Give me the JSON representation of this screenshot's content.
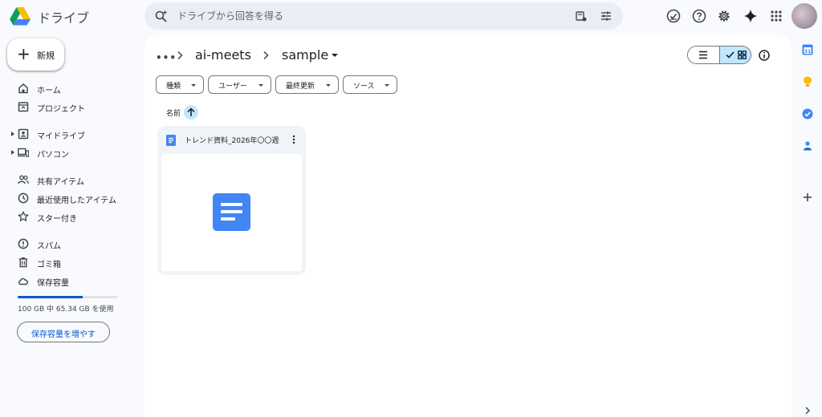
{
  "app": {
    "title": "ドライブ"
  },
  "search": {
    "placeholder": "ドライブから回答を得る"
  },
  "header_icons": [
    "offline-status-icon",
    "help-icon",
    "settings-icon",
    "gemini-icon",
    "apps-grid-icon",
    "account-avatar"
  ],
  "new_button": {
    "label": "新規"
  },
  "nav": {
    "items": [
      {
        "label": "ホーム",
        "icon": "home-icon"
      },
      {
        "label": "プロジェクト",
        "icon": "projects-icon"
      },
      {
        "label": "マイドライブ",
        "icon": "my-drive-icon",
        "expandable": true
      },
      {
        "label": "パソコン",
        "icon": "computers-icon",
        "expandable": true
      },
      {
        "label": "共有アイテム",
        "icon": "shared-icon"
      },
      {
        "label": "最近使用したアイテム",
        "icon": "recent-icon"
      },
      {
        "label": "スター付き",
        "icon": "star-icon"
      },
      {
        "label": "スパム",
        "icon": "spam-icon"
      },
      {
        "label": "ゴミ箱",
        "icon": "trash-icon"
      },
      {
        "label": "保存容量",
        "icon": "cloud-icon"
      }
    ]
  },
  "storage": {
    "used_text": "100 GB 中 65.34 GB を使用",
    "used_fraction": 0.6534,
    "button_label": "保存容量を増やす"
  },
  "breadcrumb": {
    "more": "•••",
    "parent": "ai-meets",
    "current": "sample"
  },
  "view": {
    "mode": "grid"
  },
  "filters": [
    {
      "label": "種類"
    },
    {
      "label": "ユーザー"
    },
    {
      "label": "最終更新"
    },
    {
      "label": "ソース"
    }
  ],
  "sort": {
    "label": "名前",
    "direction": "ascending"
  },
  "files": [
    {
      "name": "トレンド資料_2026年〇〇週",
      "type": "google-doc"
    }
  ],
  "side_panel": [
    "calendar-icon",
    "keep-icon",
    "tasks-icon",
    "contacts-icon",
    "add-icon"
  ],
  "colors": {
    "accent": "#0b57d0",
    "doc_blue": "#4285f4",
    "selected_bg": "#c2e7ff",
    "page_bg": "#f8fafd"
  }
}
